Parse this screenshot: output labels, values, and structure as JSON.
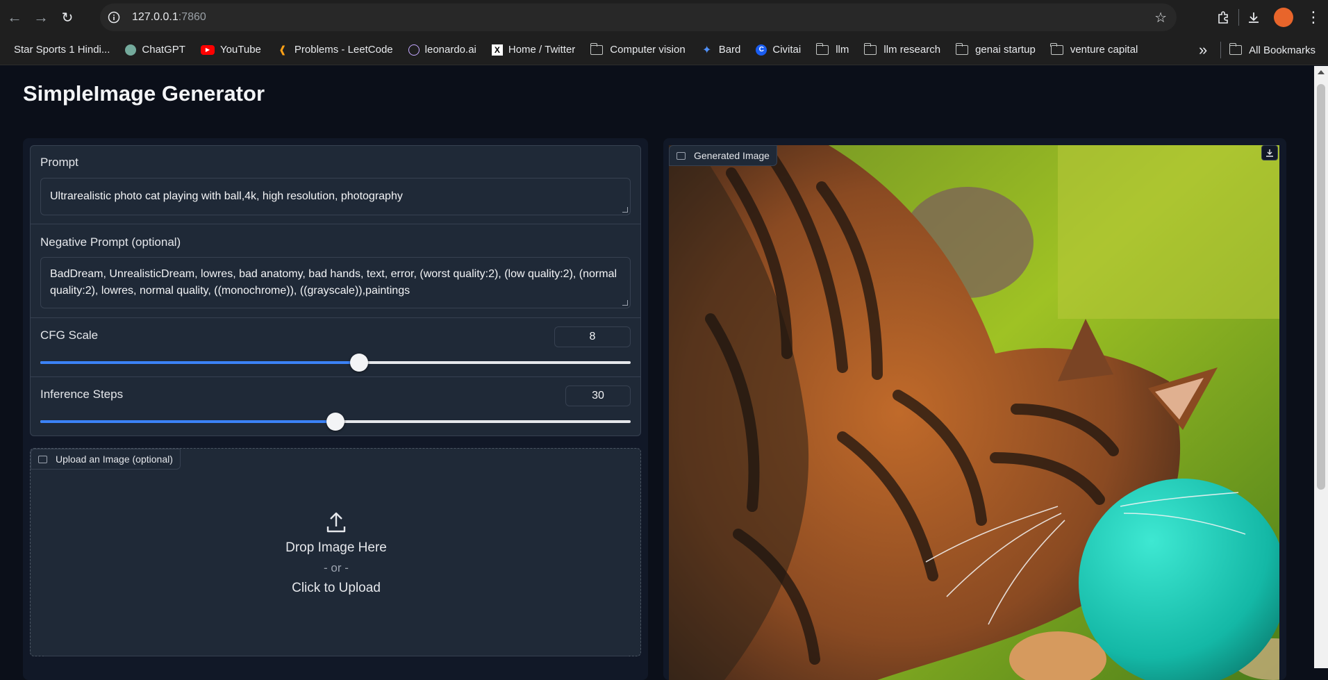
{
  "browser": {
    "url_host": "127.0.0.1",
    "url_port": ":7860",
    "bookmarks": [
      {
        "label": "Star Sports 1 Hindi...",
        "icon": "page-icon"
      },
      {
        "label": "ChatGPT",
        "icon": "chatgpt-icon"
      },
      {
        "label": "YouTube",
        "icon": "youtube-icon"
      },
      {
        "label": "Problems - LeetCode",
        "icon": "leetcode-icon"
      },
      {
        "label": "leonardo.ai",
        "icon": "leonardo-icon"
      },
      {
        "label": "Home / Twitter",
        "icon": "x-icon"
      },
      {
        "label": "Computer vision",
        "icon": "folder-icon"
      },
      {
        "label": "Bard",
        "icon": "bard-icon"
      },
      {
        "label": "Civitai",
        "icon": "civitai-icon"
      },
      {
        "label": "llm",
        "icon": "folder-icon"
      },
      {
        "label": "llm research",
        "icon": "folder-icon"
      },
      {
        "label": "genai startup",
        "icon": "folder-icon"
      },
      {
        "label": "venture capital",
        "icon": "folder-icon"
      }
    ],
    "all_bookmarks_label": "All Bookmarks",
    "overflow_label": "»"
  },
  "app": {
    "title": "SimpleImage Generator",
    "prompt": {
      "label": "Prompt",
      "value": "Ultrarealistic photo cat playing with ball,4k, high resolution, photography"
    },
    "negative_prompt": {
      "label": "Negative Prompt (optional)",
      "value": "BadDream, UnrealisticDream, lowres, bad anatomy, bad hands, text, error, (worst quality:2), (low quality:2), (normal quality:2), lowres, normal quality, ((monochrome)), ((grayscale)),paintings"
    },
    "cfg_scale": {
      "label": "CFG Scale",
      "value": "8",
      "fraction": 0.54
    },
    "inference_steps": {
      "label": "Inference Steps",
      "value": "30",
      "fraction": 0.5
    },
    "upload": {
      "label": "Upload an Image (optional)",
      "drop_text": "Drop Image Here",
      "or_text": "- or -",
      "click_text": "Click to Upload"
    },
    "output": {
      "label": "Generated Image",
      "image_description_icon": "generated-image"
    }
  },
  "colors": {
    "accent": "#3b82f6",
    "page_bg": "#0b0f19",
    "panel_bg": "#1f2937"
  }
}
